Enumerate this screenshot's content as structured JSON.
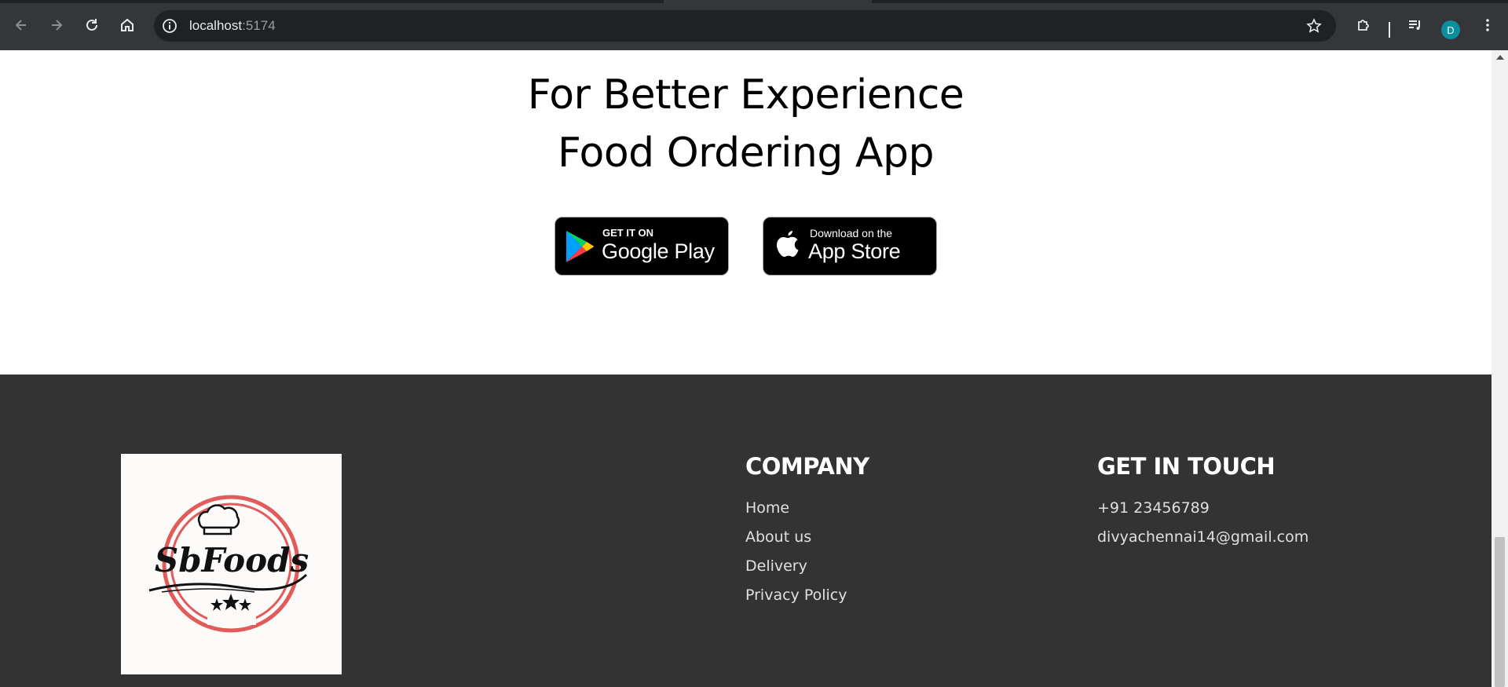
{
  "browser": {
    "url_host": "localhost",
    "url_port": ":5174",
    "avatar_letter": "D",
    "icons": [
      "back-icon",
      "forward-icon",
      "reload-icon",
      "home-icon",
      "site-info-icon",
      "bookmark-star-icon",
      "extensions-icon",
      "media-controls-icon",
      "menu-kebab-icon"
    ]
  },
  "app_promo": {
    "line1": "For Better Experience",
    "line2": "Food Ordering App",
    "google_play": {
      "small": "GET IT ON",
      "big": "Google Play"
    },
    "app_store": {
      "small": "Download on the",
      "big": "App Store"
    }
  },
  "footer": {
    "logo_text": "SbFoods",
    "company": {
      "title": "COMPANY",
      "links": [
        "Home",
        "About us",
        "Delivery",
        "Privacy Policy"
      ]
    },
    "contact": {
      "title": "GET IN TOUCH",
      "items": [
        "+91 23456789",
        "divyachennai14@gmail.com"
      ]
    }
  },
  "colors": {
    "footer_bg": "#333333",
    "accent_red": "#e25b5b",
    "chrome_bg": "#35363a"
  }
}
